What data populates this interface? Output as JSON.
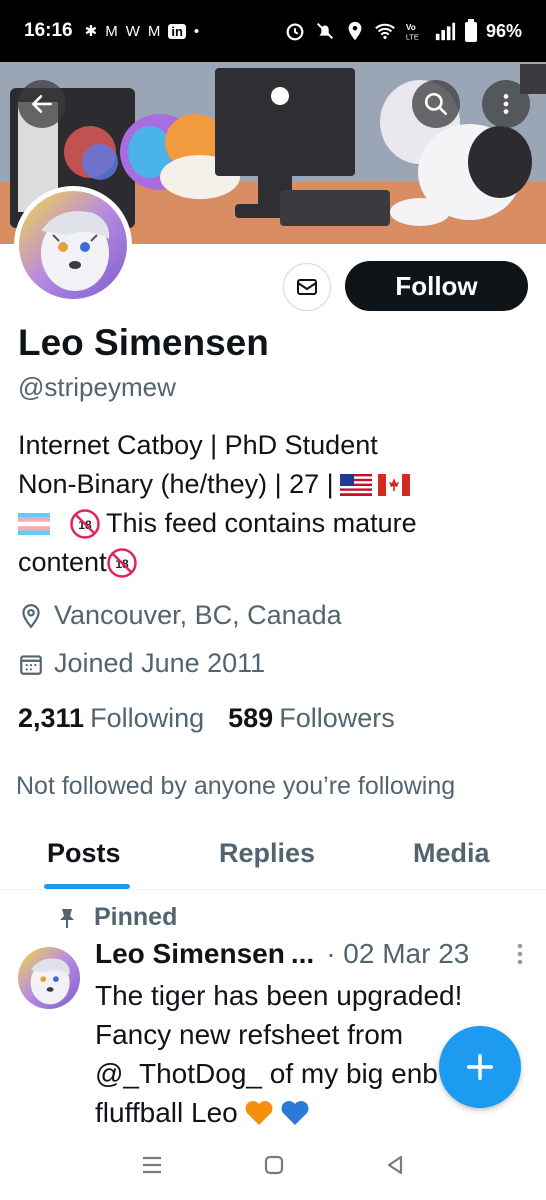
{
  "status_bar": {
    "time": "16:16",
    "notification_icons": [
      "slack-icon",
      "gmail-icon",
      "w-icon",
      "gmail-icon",
      "linkedin-icon",
      "dot-icon"
    ],
    "notification_labels": [
      "✱",
      "M",
      "W",
      "M",
      "in",
      "•"
    ],
    "battery": "96%"
  },
  "profile": {
    "display_name": "Leo Simensen",
    "handle": "@stripeymew",
    "follow_label": "Follow",
    "bio_line1": "Internet Catboy | PhD Student",
    "bio_line2": "Non-Binary (he/they) | 27 |",
    "bio_line3_text": "This feed contains mature",
    "bio_line4_text": "content",
    "location": "Vancouver, BC, Canada",
    "joined": "Joined June 2011",
    "following_count": "2,311",
    "following_label": "Following",
    "followers_count": "589",
    "followers_label": "Followers",
    "not_followed": "Not followed by anyone you’re following"
  },
  "tabs": [
    {
      "label": "Posts",
      "active": true
    },
    {
      "label": "Replies",
      "active": false
    },
    {
      "label": "Media",
      "active": false
    }
  ],
  "post": {
    "pinned_label": "Pinned",
    "author": "Leo Simensen",
    "ellipsis": "...",
    "date": "· 02 Mar 23",
    "text_line1": "The tiger has been upgraded!",
    "text_line2": "Fancy new refsheet from",
    "text_line3": "@_ThotDog_ of my big enb",
    "text_line4": "fluffball Leo"
  },
  "colors": {
    "accent": "#1d9bf0",
    "text_primary": "#0f1419",
    "text_secondary": "#536471",
    "follow_bg": "#0f1419"
  }
}
